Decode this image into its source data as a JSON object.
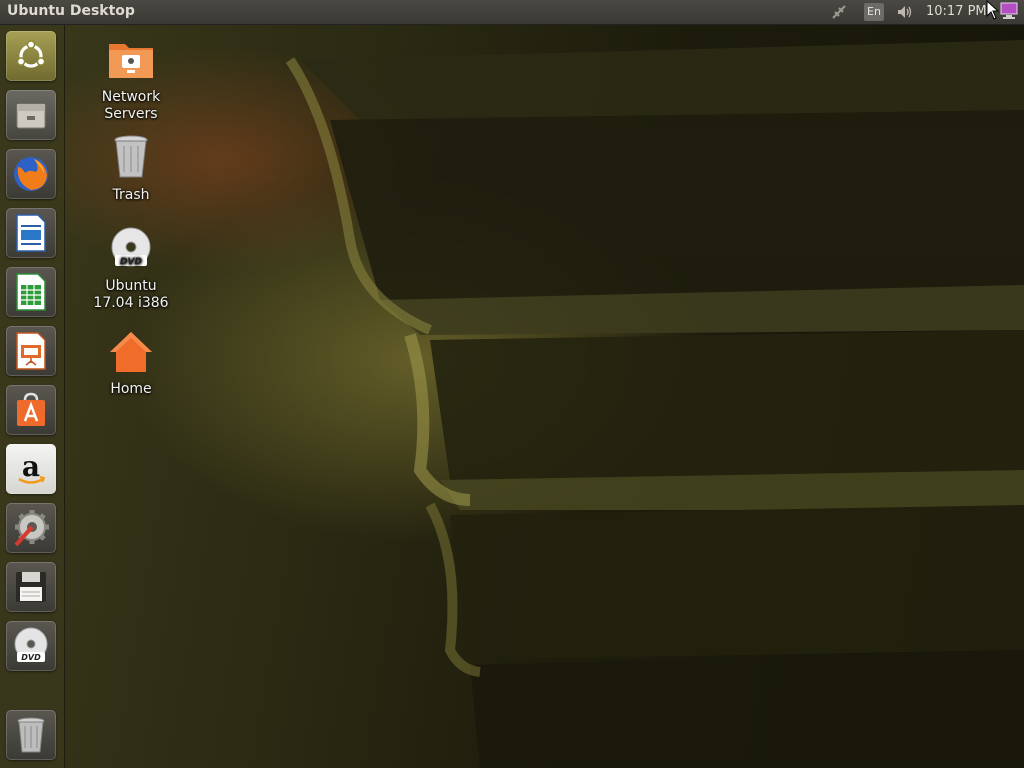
{
  "top_panel": {
    "title": "Ubuntu Desktop",
    "language": "En",
    "clock": "10:17 PM"
  },
  "launcher": {
    "items": [
      {
        "icon": "ubuntu-logo-icon"
      },
      {
        "icon": "files-icon"
      },
      {
        "icon": "firefox-icon"
      },
      {
        "icon": "libreoffice-writer-icon"
      },
      {
        "icon": "libreoffice-calc-icon"
      },
      {
        "icon": "libreoffice-impress-icon"
      },
      {
        "icon": "ubuntu-software-icon"
      },
      {
        "icon": "amazon-icon"
      },
      {
        "icon": "system-settings-icon"
      },
      {
        "icon": "floppy-disk-icon"
      },
      {
        "icon": "dvd-icon"
      },
      {
        "icon": "trash-icon"
      }
    ]
  },
  "desktop": {
    "icons": [
      {
        "label": "Network\nServers",
        "icon": "network-folder-icon"
      },
      {
        "label": "Trash",
        "icon": "trash-icon"
      },
      {
        "label": "Ubuntu\n17.04 i386",
        "icon": "dvd-icon"
      },
      {
        "label": "Home",
        "icon": "home-icon"
      }
    ]
  },
  "colors": {
    "panel": "#3c3b37",
    "launcher": "#3a381c",
    "ubuntu_orange": "#e95420"
  }
}
